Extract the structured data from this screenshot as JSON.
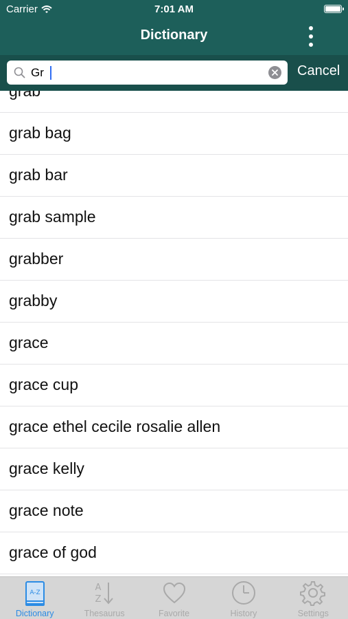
{
  "status_bar": {
    "carrier": "Carrier",
    "time": "7:01 AM"
  },
  "nav": {
    "title": "Dictionary",
    "more_icon": "more-vertical-icon"
  },
  "search": {
    "value": "Gr",
    "cancel_label": "Cancel"
  },
  "results": [
    "grab",
    "grab bag",
    "grab bar",
    "grab sample",
    "grabber",
    "grabby",
    "grace",
    "grace cup",
    "grace ethel cecile rosalie allen",
    "grace kelly",
    "grace note",
    "grace of god"
  ],
  "tabs": [
    {
      "label": "Dictionary",
      "icon": "book-icon",
      "active": true
    },
    {
      "label": "Thesaurus",
      "icon": "az-sort-icon",
      "active": false
    },
    {
      "label": "Favorite",
      "icon": "heart-icon",
      "active": false
    },
    {
      "label": "History",
      "icon": "clock-icon",
      "active": false
    },
    {
      "label": "Settings",
      "icon": "gear-icon",
      "active": false
    }
  ],
  "colors": {
    "nav_bg": "#1d5f5a",
    "search_bar_bg": "#194f4b",
    "tab_active": "#2b8be4",
    "tab_inactive": "#a9a9a9"
  }
}
